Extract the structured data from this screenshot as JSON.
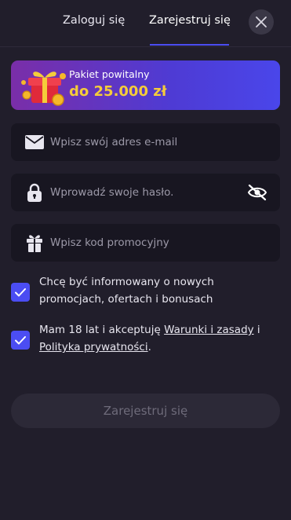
{
  "tabs": {
    "login_label": "Zaloguj się",
    "register_label": "Zarejestruj się",
    "active": "register"
  },
  "promo": {
    "label": "Pakiet powitalny",
    "amount": "do 25.000 zł",
    "icon": "gift-box-icon"
  },
  "form": {
    "email": {
      "placeholder": "Wpisz swój adres e-mail",
      "value": "",
      "icon": "envelope-icon"
    },
    "password": {
      "placeholder": "Wprowadź swoje hasło.",
      "value": "",
      "icon": "lock-icon",
      "toggle_icon": "eye-off-icon"
    },
    "promo_code": {
      "placeholder": "Wpisz kod promocyjny",
      "value": "",
      "icon": "gift-icon"
    }
  },
  "consents": {
    "marketing": {
      "checked": true,
      "text": "Chcę być informowany o nowych promocjach, ofertach i bonusach"
    },
    "terms": {
      "checked": true,
      "prefix": "Mam 18 lat i akceptuję ",
      "terms_link": "Warunki i zasady",
      "middle": " i ",
      "privacy_link": "Polityka prywatności",
      "suffix": "."
    }
  },
  "submit_label": "Zarejestruj się",
  "colors": {
    "background": "#211e2b",
    "field": "#181621",
    "accent": "#4b4df2",
    "promo_amount": "#f5cc3a",
    "button_disabled": "#2c2937"
  }
}
